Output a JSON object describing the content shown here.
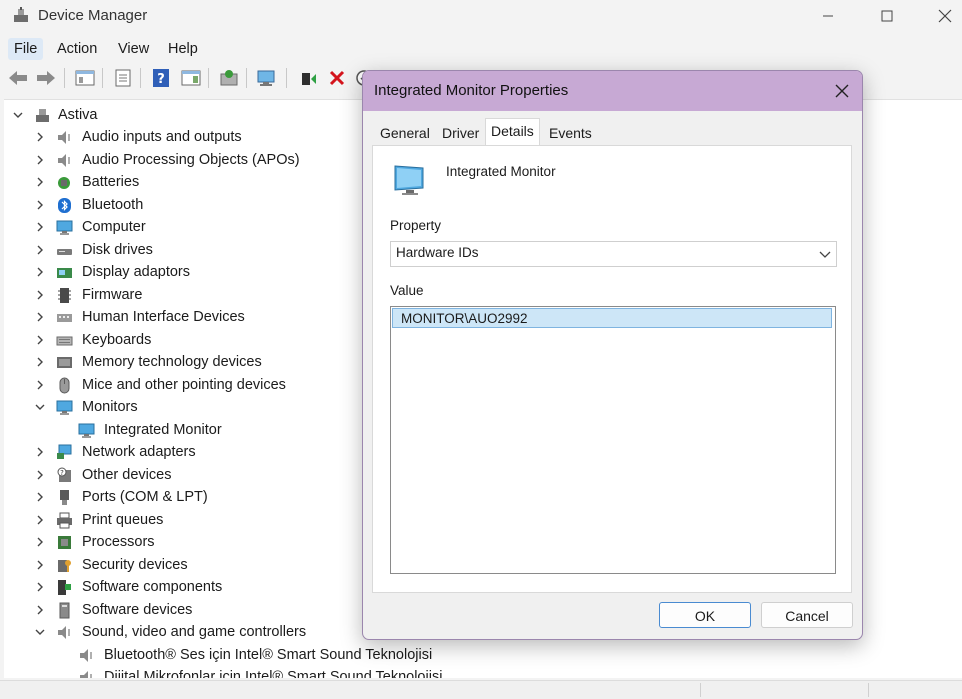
{
  "window": {
    "title": "Device Manager"
  },
  "menu": [
    "File",
    "Action",
    "View",
    "Help"
  ],
  "tree": {
    "root": "Astiva",
    "items": [
      {
        "label": "Audio inputs and outputs",
        "icon": "speaker-icon",
        "expanded": false
      },
      {
        "label": "Audio Processing Objects (APOs)",
        "icon": "speaker-icon",
        "expanded": false
      },
      {
        "label": "Batteries",
        "icon": "battery-icon",
        "expanded": false
      },
      {
        "label": "Bluetooth",
        "icon": "bluetooth-icon",
        "expanded": false
      },
      {
        "label": "Computer",
        "icon": "computer-icon",
        "expanded": false
      },
      {
        "label": "Disk drives",
        "icon": "disk-drive-icon",
        "expanded": false
      },
      {
        "label": "Display adaptors",
        "icon": "display-adapter-icon",
        "expanded": false
      },
      {
        "label": "Firmware",
        "icon": "firmware-icon",
        "expanded": false
      },
      {
        "label": "Human Interface Devices",
        "icon": "hid-icon",
        "expanded": false
      },
      {
        "label": "Keyboards",
        "icon": "keyboard-icon",
        "expanded": false
      },
      {
        "label": "Memory technology devices",
        "icon": "memory-icon",
        "expanded": false
      },
      {
        "label": "Mice and other pointing devices",
        "icon": "mouse-icon",
        "expanded": false
      },
      {
        "label": "Monitors",
        "icon": "monitor-icon",
        "expanded": true
      },
      {
        "label": "Integrated Monitor",
        "icon": "monitor-icon",
        "child": true
      },
      {
        "label": "Network adapters",
        "icon": "network-icon",
        "expanded": false
      },
      {
        "label": "Other devices",
        "icon": "unknown-device-icon",
        "expanded": false
      },
      {
        "label": "Ports (COM & LPT)",
        "icon": "port-icon",
        "expanded": false
      },
      {
        "label": "Print queues",
        "icon": "printer-icon",
        "expanded": false
      },
      {
        "label": "Processors",
        "icon": "processor-icon",
        "expanded": false
      },
      {
        "label": "Security devices",
        "icon": "security-icon",
        "expanded": false
      },
      {
        "label": "Software components",
        "icon": "software-component-icon",
        "expanded": false
      },
      {
        "label": "Software devices",
        "icon": "software-device-icon",
        "expanded": false
      },
      {
        "label": "Sound, video and game controllers",
        "icon": "speaker-icon",
        "expanded": true
      },
      {
        "label": "Bluetooth® Ses için Intel® Smart Sound Teknolojisi",
        "icon": "speaker-icon",
        "child": true
      },
      {
        "label": "Dijital Mikrofonlar için Intel® Smart Sound Teknolojisi",
        "icon": "speaker-icon",
        "child": true
      }
    ]
  },
  "dialog": {
    "title": "Integrated Monitor Properties",
    "tabs": [
      "General",
      "Driver",
      "Details",
      "Events"
    ],
    "selected_tab": "Details",
    "device_name": "Integrated Monitor",
    "property_label": "Property",
    "property_value": "Hardware IDs",
    "value_label": "Value",
    "values": [
      "MONITOR\\AUO2992"
    ],
    "ok_label": "OK",
    "cancel_label": "Cancel"
  },
  "colors": {
    "dialog_title": "#c7a9d4",
    "selection": "#cde6f7",
    "accent": "#4a8bd1"
  }
}
